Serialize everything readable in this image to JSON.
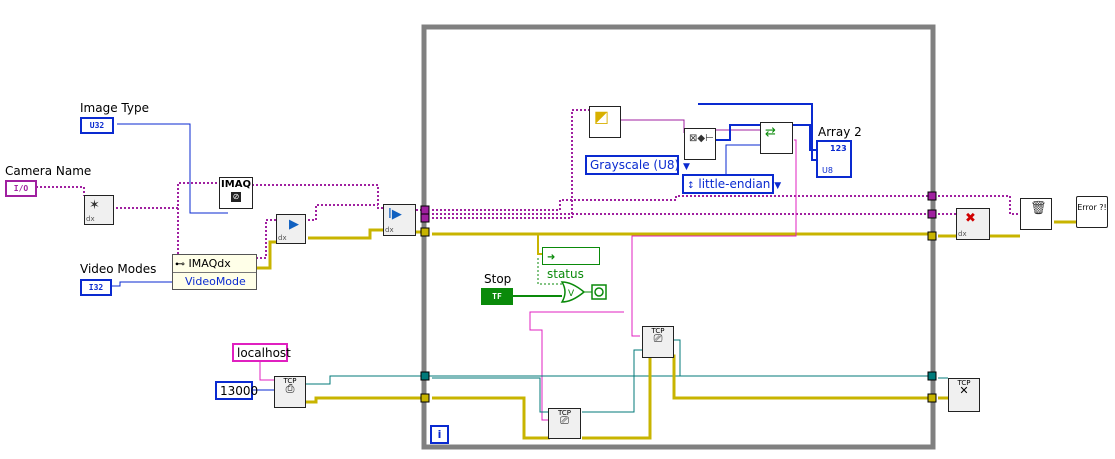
{
  "controls": {
    "image_type": {
      "label": "Image Type",
      "type_tag": "U32"
    },
    "camera_name": {
      "label": "Camera Name",
      "type_tag": "I/O"
    },
    "video_modes": {
      "label": "Video Modes",
      "type_tag": "I32"
    },
    "stop": {
      "label": "Stop",
      "type_tag": "TF"
    }
  },
  "constants": {
    "host": "localhost",
    "port": "13000",
    "image_type_ring": "Grayscale (U8)",
    "endianness_ring": "little-endian"
  },
  "nodes": {
    "imaqdx_property": {
      "class": "IMAQdx",
      "property": "VideoMode"
    },
    "imaq_create": {
      "text": "IMAQ"
    },
    "error_handler": {
      "text": "Error ?!"
    },
    "dx_tag": "dx",
    "tcp_tag": "TCP"
  },
  "indicators": {
    "status": "status",
    "array2": {
      "label": "Array 2",
      "type_tag": "U8",
      "index_tag": "123"
    }
  },
  "loop": {
    "iteration_terminal": "i"
  },
  "colors": {
    "io_wire": "#a020a0",
    "numeric_wire": "#0a2ad0",
    "error_wire": "#c8b400",
    "tcp_wire": "#007a7a",
    "boolean_wire": "#0a8a0a",
    "string_wire": "#e020c0",
    "loop_frame": "#808080"
  }
}
